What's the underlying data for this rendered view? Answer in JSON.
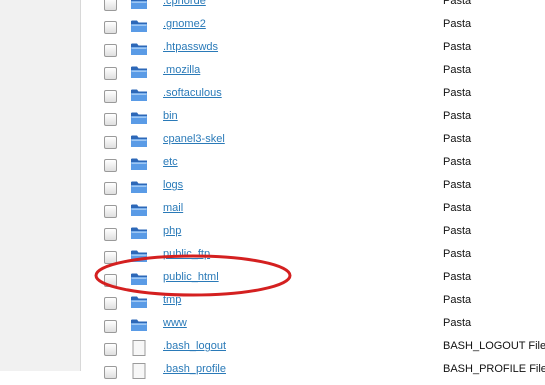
{
  "files": [
    {
      "name": ".cpnorde",
      "type": "Pasta",
      "icon": "folder-icon"
    },
    {
      "name": ".gnome2",
      "type": "Pasta",
      "icon": "folder-icon"
    },
    {
      "name": ".htpasswds",
      "type": "Pasta",
      "icon": "folder-icon"
    },
    {
      "name": ".mozilla",
      "type": "Pasta",
      "icon": "folder-icon"
    },
    {
      "name": ".softaculous",
      "type": "Pasta",
      "icon": "folder-icon"
    },
    {
      "name": "bin",
      "type": "Pasta",
      "icon": "folder-icon"
    },
    {
      "name": "cpanel3-skel",
      "type": "Pasta",
      "icon": "folder-icon"
    },
    {
      "name": "etc",
      "type": "Pasta",
      "icon": "folder-icon"
    },
    {
      "name": "logs",
      "type": "Pasta",
      "icon": "folder-icon"
    },
    {
      "name": "mail",
      "type": "Pasta",
      "icon": "folder-icon"
    },
    {
      "name": "php",
      "type": "Pasta",
      "icon": "folder-icon"
    },
    {
      "name": "public_ftp",
      "type": "Pasta",
      "icon": "folder-icon"
    },
    {
      "name": "public_html",
      "type": "Pasta",
      "icon": "folder-icon"
    },
    {
      "name": "tmp",
      "type": "Pasta",
      "icon": "folder-icon"
    },
    {
      "name": "www",
      "type": "Pasta",
      "icon": "folder-icon"
    },
    {
      "name": ".bash_logout",
      "type": "BASH_LOGOUT File",
      "icon": "file-icon"
    },
    {
      "name": ".bash_profile",
      "type": "BASH_PROFILE File",
      "icon": "file-icon"
    }
  ],
  "colors": {
    "link": "#2a7ab8",
    "folder": "#3f83d6",
    "highlight": "#d42020"
  }
}
